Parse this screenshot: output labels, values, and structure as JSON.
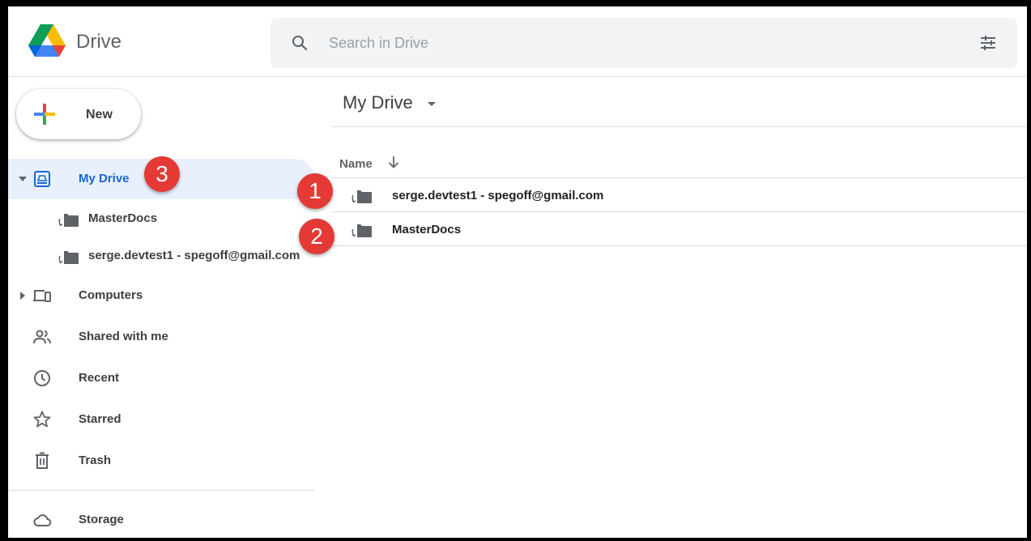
{
  "header": {
    "brand": "Drive",
    "search_placeholder": "Search in Drive"
  },
  "sidebar": {
    "new_label": "New",
    "my_drive_label": "My Drive",
    "tree": [
      {
        "label": "MasterDocs"
      },
      {
        "label": "serge.devtest1 - spegoff@gmail.com"
      }
    ],
    "items": [
      {
        "label": "Computers",
        "icon": "computers-icon"
      },
      {
        "label": "Shared with me",
        "icon": "shared-icon"
      },
      {
        "label": "Recent",
        "icon": "clock-icon"
      },
      {
        "label": "Starred",
        "icon": "star-icon"
      },
      {
        "label": "Trash",
        "icon": "trash-icon"
      }
    ],
    "storage_label": "Storage"
  },
  "main": {
    "title": "My Drive",
    "column_name": "Name",
    "files": [
      {
        "name": "serge.devtest1 - spegoff@gmail.com",
        "type": "shared-shortcut-folder"
      },
      {
        "name": "MasterDocs",
        "type": "shared-shortcut-folder"
      }
    ]
  },
  "annotations": {
    "badge_1": "1",
    "badge_2": "2",
    "badge_3": "3",
    "color": "#e53935"
  },
  "colors": {
    "active_bg": "#e8f0fe",
    "active_text": "#1967d2",
    "search_bg": "#f1f3f4"
  }
}
